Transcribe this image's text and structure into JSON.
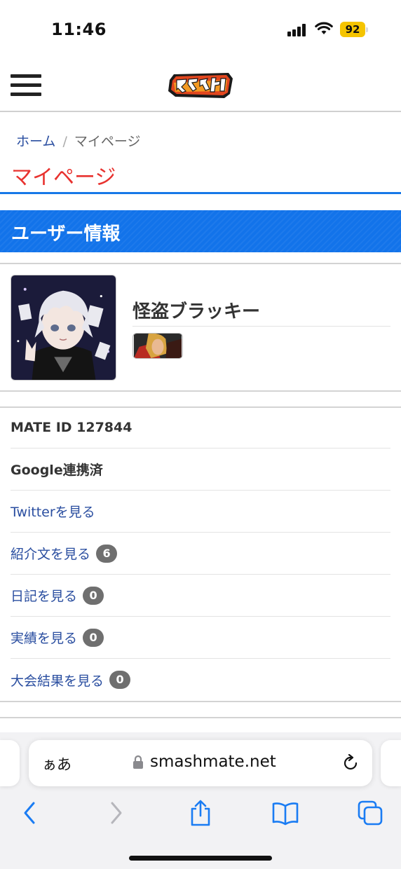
{
  "status_bar": {
    "time": "11:46",
    "battery": "92"
  },
  "header": {
    "logo_alt": "スマメイト"
  },
  "breadcrumb": {
    "home": "ホーム",
    "separator": "/",
    "current": "マイページ"
  },
  "page_title": "マイページ",
  "section_title": "ユーザー情報",
  "profile": {
    "username": "怪盗ブラッキー"
  },
  "info": {
    "mate_id": "MATE ID 127844",
    "google": "Google連携済",
    "twitter": "Twitterを見る",
    "intro": {
      "label": "紹介文を見る",
      "count": "6"
    },
    "diary": {
      "label": "日記を見る",
      "count": "0"
    },
    "achievements": {
      "label": "実績を見る",
      "count": "0"
    },
    "tournaments": {
      "label": "大会結果を見る",
      "count": "0"
    }
  },
  "browser": {
    "aa_label": "ぁあ",
    "url": "smashmate.net"
  },
  "colors": {
    "accent_red": "#e8322f",
    "banner_blue": "#1273ea",
    "link_blue": "#2a4ea0",
    "ios_blue": "#1a7cf3"
  }
}
